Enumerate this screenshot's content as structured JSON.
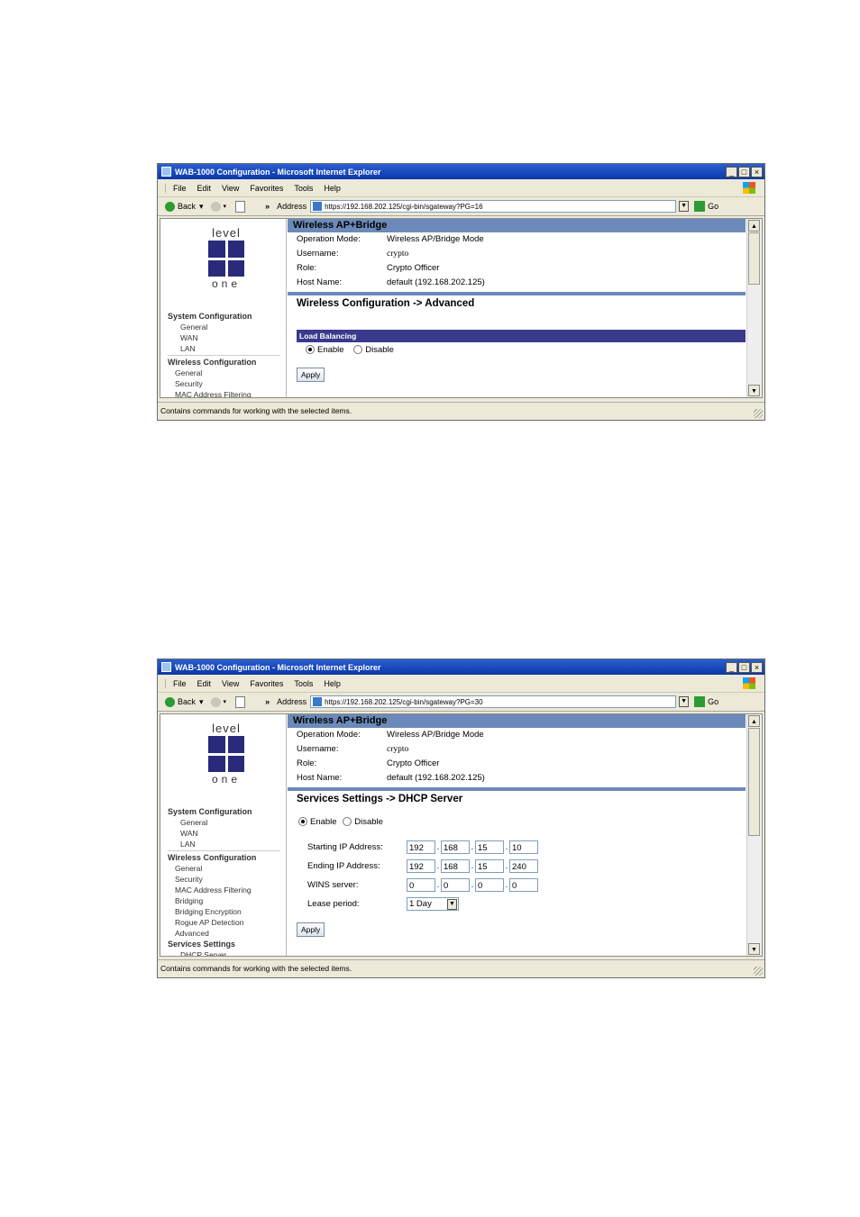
{
  "windows": [
    {
      "title": "WAB-1000 Configuration - Microsoft Internet Explorer",
      "menu": [
        "File",
        "Edit",
        "View",
        "Favorites",
        "Tools",
        "Help"
      ],
      "nav": {
        "back": "Back",
        "address_label": "Address",
        "url": "https://192.168.202.125/cgi-bin/sgateway?PG=16",
        "go": "Go"
      },
      "logo": {
        "top": "level",
        "bottom": "one"
      },
      "sidebar": [
        {
          "text": "System Configuration",
          "kind": "grp"
        },
        {
          "text": "General",
          "kind": "it"
        },
        {
          "text": "WAN",
          "kind": "it"
        },
        {
          "text": "LAN",
          "kind": "it"
        },
        {
          "text": "Wireless Configuration",
          "kind": "grp"
        },
        {
          "text": "General",
          "kind": "it2"
        },
        {
          "text": "Security",
          "kind": "it2"
        },
        {
          "text": "MAC Address Filtering",
          "kind": "it2"
        }
      ],
      "header": "Wireless AP+Bridge",
      "info": [
        {
          "k": "Operation Mode:",
          "v": "Wireless AP/Bridge Mode"
        },
        {
          "k": "Username:",
          "v": "crypto"
        },
        {
          "k": "Role:",
          "v": "Crypto Officer"
        },
        {
          "k": "Host Name:",
          "v": "default (192.168.202.125)"
        }
      ],
      "section_title": "Wireless Configuration -> Advanced",
      "load_balancing_label": "Load Balancing",
      "radio": {
        "enable": "Enable",
        "disable": "Disable",
        "selected": "enable"
      },
      "apply": "Apply",
      "status": "Contains commands for working with the selected items."
    },
    {
      "title": "WAB-1000 Configuration - Microsoft Internet Explorer",
      "menu": [
        "File",
        "Edit",
        "View",
        "Favorites",
        "Tools",
        "Help"
      ],
      "nav": {
        "back": "Back",
        "address_label": "Address",
        "url": "https://192.168.202.125/cgi-bin/sgateway?PG=30",
        "go": "Go"
      },
      "logo": {
        "top": "level",
        "bottom": "one"
      },
      "sidebar": [
        {
          "text": "System Configuration",
          "kind": "grp"
        },
        {
          "text": "General",
          "kind": "it"
        },
        {
          "text": "WAN",
          "kind": "it"
        },
        {
          "text": "LAN",
          "kind": "it"
        },
        {
          "text": "Wireless Configuration",
          "kind": "grp"
        },
        {
          "text": "General",
          "kind": "it2"
        },
        {
          "text": "Security",
          "kind": "it2"
        },
        {
          "text": "MAC Address Filtering",
          "kind": "it2"
        },
        {
          "text": "Bridging",
          "kind": "it2"
        },
        {
          "text": "Bridging Encryption",
          "kind": "it2"
        },
        {
          "text": "Rogue AP Detection",
          "kind": "it2"
        },
        {
          "text": "Advanced",
          "kind": "it2"
        },
        {
          "text": "Services Settings",
          "kind": "grp"
        },
        {
          "text": "DHCP Server",
          "kind": "it"
        }
      ],
      "header": "Wireless AP+Bridge",
      "info": [
        {
          "k": "Operation Mode:",
          "v": "Wireless AP/Bridge Mode"
        },
        {
          "k": "Username:",
          "v": "crypto"
        },
        {
          "k": "Role:",
          "v": "Crypto Officer"
        },
        {
          "k": "Host Name:",
          "v": "default (192.168.202.125)"
        }
      ],
      "section_title": "Services Settings -> DHCP Server",
      "radio": {
        "enable": "Enable",
        "disable": "Disable",
        "selected": "enable"
      },
      "form": {
        "starting_ip": {
          "label": "Starting IP Address:",
          "octets": [
            "192",
            "168",
            "15",
            "10"
          ]
        },
        "ending_ip": {
          "label": "Ending IP Address:",
          "octets": [
            "192",
            "168",
            "15",
            "240"
          ]
        },
        "wins": {
          "label": "WINS server:",
          "octets": [
            "0",
            "0",
            "0",
            "0"
          ]
        },
        "lease": {
          "label": "Lease period:",
          "value": "1 Day"
        }
      },
      "apply": "Apply",
      "status": "Contains commands for working with the selected items."
    }
  ]
}
